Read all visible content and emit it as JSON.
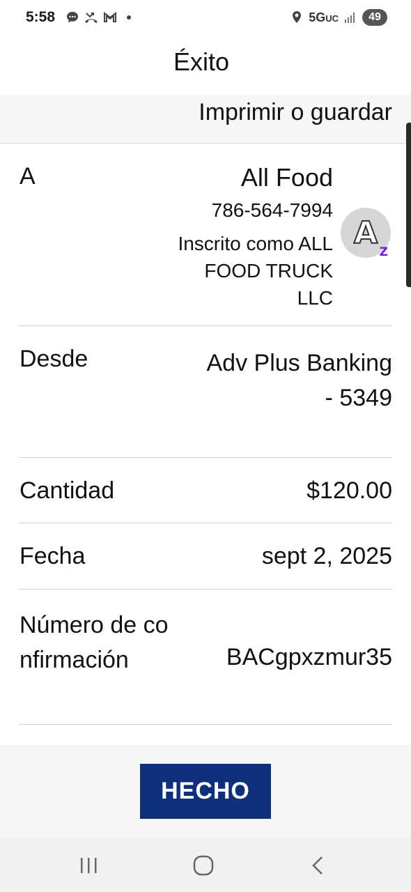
{
  "status_bar": {
    "time": "5:58",
    "network": "5G",
    "network_suffix": "UC",
    "battery": "49",
    "icons": [
      "chat-icon",
      "missed-call-icon",
      "gmail-icon",
      "dot-icon",
      "location-icon",
      "signal-icon"
    ]
  },
  "header": {
    "title": "Éxito",
    "print_label": "Imprimir o guardar"
  },
  "details": {
    "to": {
      "label": "A",
      "name": "All Food",
      "phone": "786-564-7994",
      "registered": "Inscrito como ALL FOOD TRUCK LLC",
      "avatar_letter": "A",
      "badge": "Z"
    },
    "from": {
      "label": "Desde",
      "value_line1": "Adv Plus Banking",
      "value_line2": "- 5349"
    },
    "amount": {
      "label": "Cantidad",
      "value": "$120.00"
    },
    "date": {
      "label": "Fecha",
      "value": "sept 2, 2025"
    },
    "confirmation": {
      "label": "Número de confirmación",
      "value": "BACgpxzmur35"
    }
  },
  "footer": {
    "done_label": "HECHO"
  },
  "nav_bar": {
    "icons": [
      "recent-apps-icon",
      "home-icon",
      "back-icon"
    ]
  },
  "colors": {
    "button_bg": "#0f2f7a",
    "zelle_purple": "#6d1ed4"
  }
}
